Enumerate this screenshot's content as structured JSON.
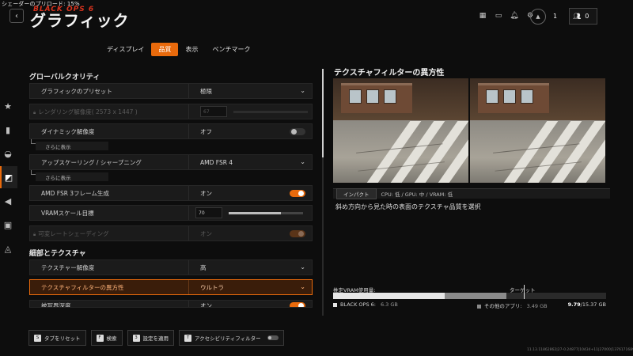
{
  "overlay": {
    "shader_status": "シェーダーのプリロード: 15%",
    "logo": "BLACK OPS 6"
  },
  "header": {
    "back": "‹",
    "title": "グラフィック",
    "party_count": "1",
    "friends_count": "0"
  },
  "tabs": [
    {
      "label": "ディスプレイ"
    },
    {
      "label": "品質"
    },
    {
      "label": "表示"
    },
    {
      "label": "ベンチマーク"
    }
  ],
  "rail_icons": [
    "star-icon",
    "ammo-icon",
    "controller-icon",
    "graphics-icon",
    "audio-icon",
    "interface-icon",
    "account-icon"
  ],
  "global_quality": {
    "title": "グローバルクオリティ",
    "preset": {
      "label": "グラフィックのプリセット",
      "value": "極限"
    },
    "render_res": {
      "label": "レンダリング解像度( 2573 x 1447 )",
      "value": "67"
    },
    "dynamic_res": {
      "label": "ダイナミック解像度",
      "value": "オフ"
    },
    "show_more_1": "さらに表示",
    "upscaling": {
      "label": "アップスケーリング / シャープニング",
      "value": "AMD FSR 4"
    },
    "show_more_2": "さらに表示",
    "frame_gen": {
      "label": "AMD FSR 3フレーム生成",
      "value": "オン"
    },
    "vram_scale": {
      "label": "VRAMスケール目標",
      "value": "70"
    },
    "vrs": {
      "label": "可変レートシェーディング",
      "value": "オン"
    }
  },
  "detail_texture": {
    "title": "細部とテクスチャ",
    "texture_res": {
      "label": "テクスチャー解像度",
      "value": "高"
    },
    "aniso": {
      "label": "テクスチャフィルターの異方性",
      "value": "ウルトラ"
    },
    "depth_partial": {
      "label": "被写界深度",
      "value": "オン"
    }
  },
  "info": {
    "title": "テクスチャフィルターの異方性",
    "impact_label": "インパクト",
    "impact_stats": "CPU: 低 / GPU: 中 / VRAM: 低",
    "description": "斜め方向から見た時の表面のテクスチャ品質を選択"
  },
  "vram": {
    "label": "推定VRAM使用量:",
    "target_label": "ターゲット",
    "bo6_label": "BLACK OPS 6:",
    "bo6_value": "6.3 GB",
    "other_label": "その他のアプリ:",
    "other_value": "3.49 GB",
    "total_used": "9.79",
    "total_max": "/15.37 GB",
    "bo6_fraction": 0.41,
    "other_fraction": 0.227,
    "target_fraction": 0.7
  },
  "bottom_bar": {
    "reset": {
      "key": "S",
      "label": "タブをリセット"
    },
    "search": {
      "key": "F",
      "label": "検索"
    },
    "apply": {
      "key": "3",
      "label": "設定を適用"
    },
    "a11y": {
      "key": "T",
      "label": "アクセシビリティフィルター"
    }
  },
  "build_id": "11.13.11862862|27-0.24877|10434+11|27000|13761716893.pl.5.release3"
}
